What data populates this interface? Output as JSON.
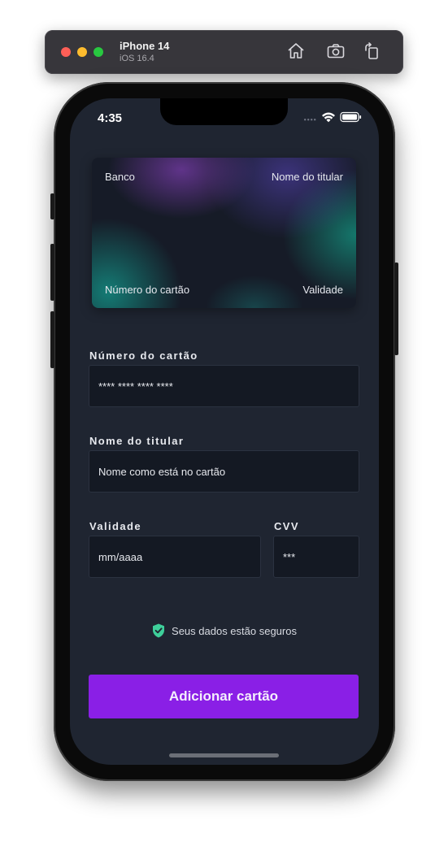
{
  "simulator": {
    "device_name": "iPhone 14",
    "os_version": "iOS 16.4",
    "buttons": [
      "home-icon",
      "screenshot-icon",
      "rotate-icon"
    ]
  },
  "status_bar": {
    "time": "4:35",
    "icons": [
      "signal-icon",
      "wifi-icon",
      "battery-icon"
    ]
  },
  "card_preview": {
    "bank": "Banco",
    "holder": "Nome do titular",
    "number": "Número do cartão",
    "expiry": "Validade"
  },
  "form": {
    "card_number": {
      "label": "Número do cartão",
      "placeholder": "**** **** **** ****",
      "value": ""
    },
    "holder_name": {
      "label": "Nome do titular",
      "placeholder": "Nome como está no cartão",
      "value": ""
    },
    "expiry": {
      "label": "Validade",
      "placeholder": "mm/aaaa",
      "value": ""
    },
    "cvv": {
      "label": "CVV",
      "placeholder": "***",
      "value": ""
    }
  },
  "security_note": {
    "text": "Seus dados estão seguros",
    "icon": "shield-check-icon",
    "icon_color": "#3ecf9a"
  },
  "submit": {
    "label": "Adicionar cartão",
    "color": "#8a1fe6"
  },
  "colors": {
    "screen_bg": "#1f2531",
    "field_bg": "#141923"
  }
}
